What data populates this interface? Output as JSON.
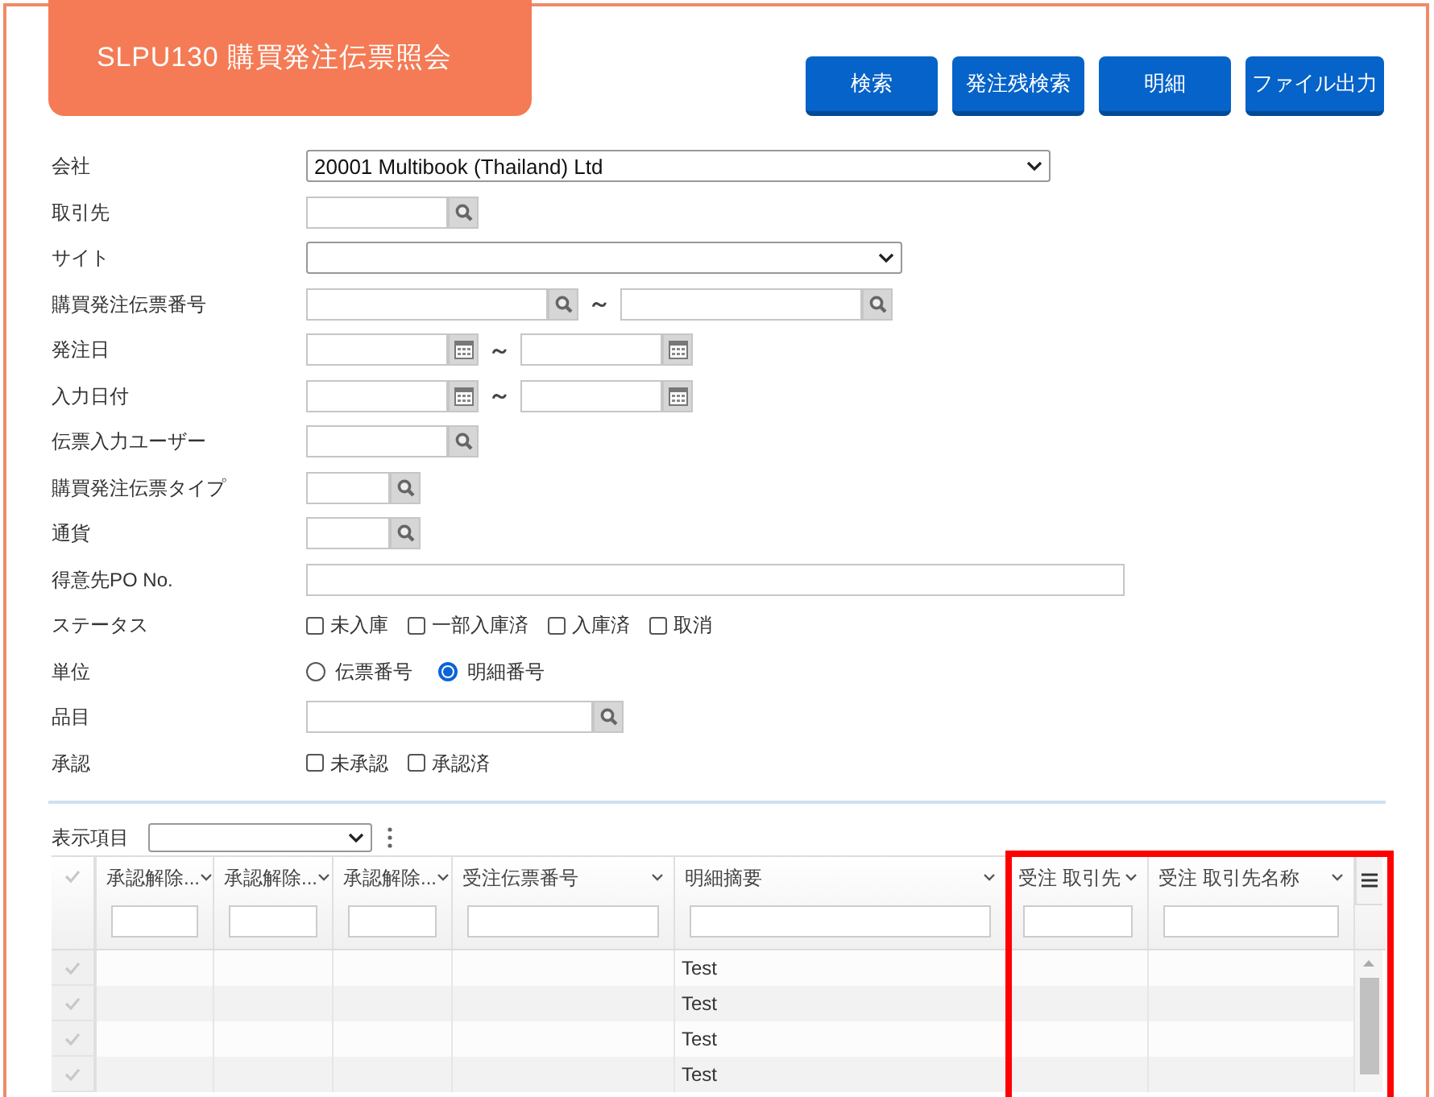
{
  "title": "SLPU130 購買発注伝票照会",
  "buttons": [
    {
      "label": "検索"
    },
    {
      "label": "発注残検索"
    },
    {
      "label": "明細"
    },
    {
      "label": "ファイル出力"
    }
  ],
  "form": [
    {
      "label": "会社",
      "kind": "select",
      "value": "20001 Multibook (Thailand) Ltd"
    },
    {
      "label": "取引先",
      "kind": "lookup"
    },
    {
      "label": "サイト",
      "kind": "select"
    },
    {
      "label": "購買発注伝票番号",
      "kind": "lookup_range",
      "separator": "～"
    },
    {
      "label": "発注日",
      "kind": "date_range",
      "separator": "～"
    },
    {
      "label": "入力日付",
      "kind": "date_range",
      "separator": "～"
    },
    {
      "label": "伝票入力ユーザー",
      "kind": "lookup"
    },
    {
      "label": "購買発注伝票タイプ",
      "kind": "lookup"
    },
    {
      "label": "通貨",
      "kind": "lookup"
    },
    {
      "label": "得意先PO No.",
      "kind": "text"
    },
    {
      "label": "ステータス",
      "kind": "checkboxes",
      "options": [
        {
          "label": "未入庫",
          "checked": false
        },
        {
          "label": "一部入庫済",
          "checked": false
        },
        {
          "label": "入庫済",
          "checked": false
        },
        {
          "label": "取消",
          "checked": false
        }
      ]
    },
    {
      "label": "単位",
      "kind": "radios",
      "options": [
        {
          "label": "伝票番号",
          "selected": false
        },
        {
          "label": "明細番号",
          "selected": true
        }
      ]
    },
    {
      "label": "品目",
      "kind": "lookup"
    },
    {
      "label": "承認",
      "kind": "checkboxes",
      "options": [
        {
          "label": "未承認",
          "checked": false
        },
        {
          "label": "承認済",
          "checked": false
        }
      ]
    }
  ],
  "display_items": {
    "label": "表示項目"
  },
  "grid": {
    "columns": [
      {
        "label": "承認解除..."
      },
      {
        "label": "承認解除..."
      },
      {
        "label": "承認解除..."
      },
      {
        "label": "受注伝票番号"
      },
      {
        "label": "明細摘要"
      },
      {
        "label": "受注 取引先"
      },
      {
        "label": "受注 取引先名称"
      }
    ],
    "rows": [
      {
        "detail_summary": "Test"
      },
      {
        "detail_summary": "Test"
      },
      {
        "detail_summary": "Test"
      },
      {
        "detail_summary": "Test"
      }
    ]
  }
}
